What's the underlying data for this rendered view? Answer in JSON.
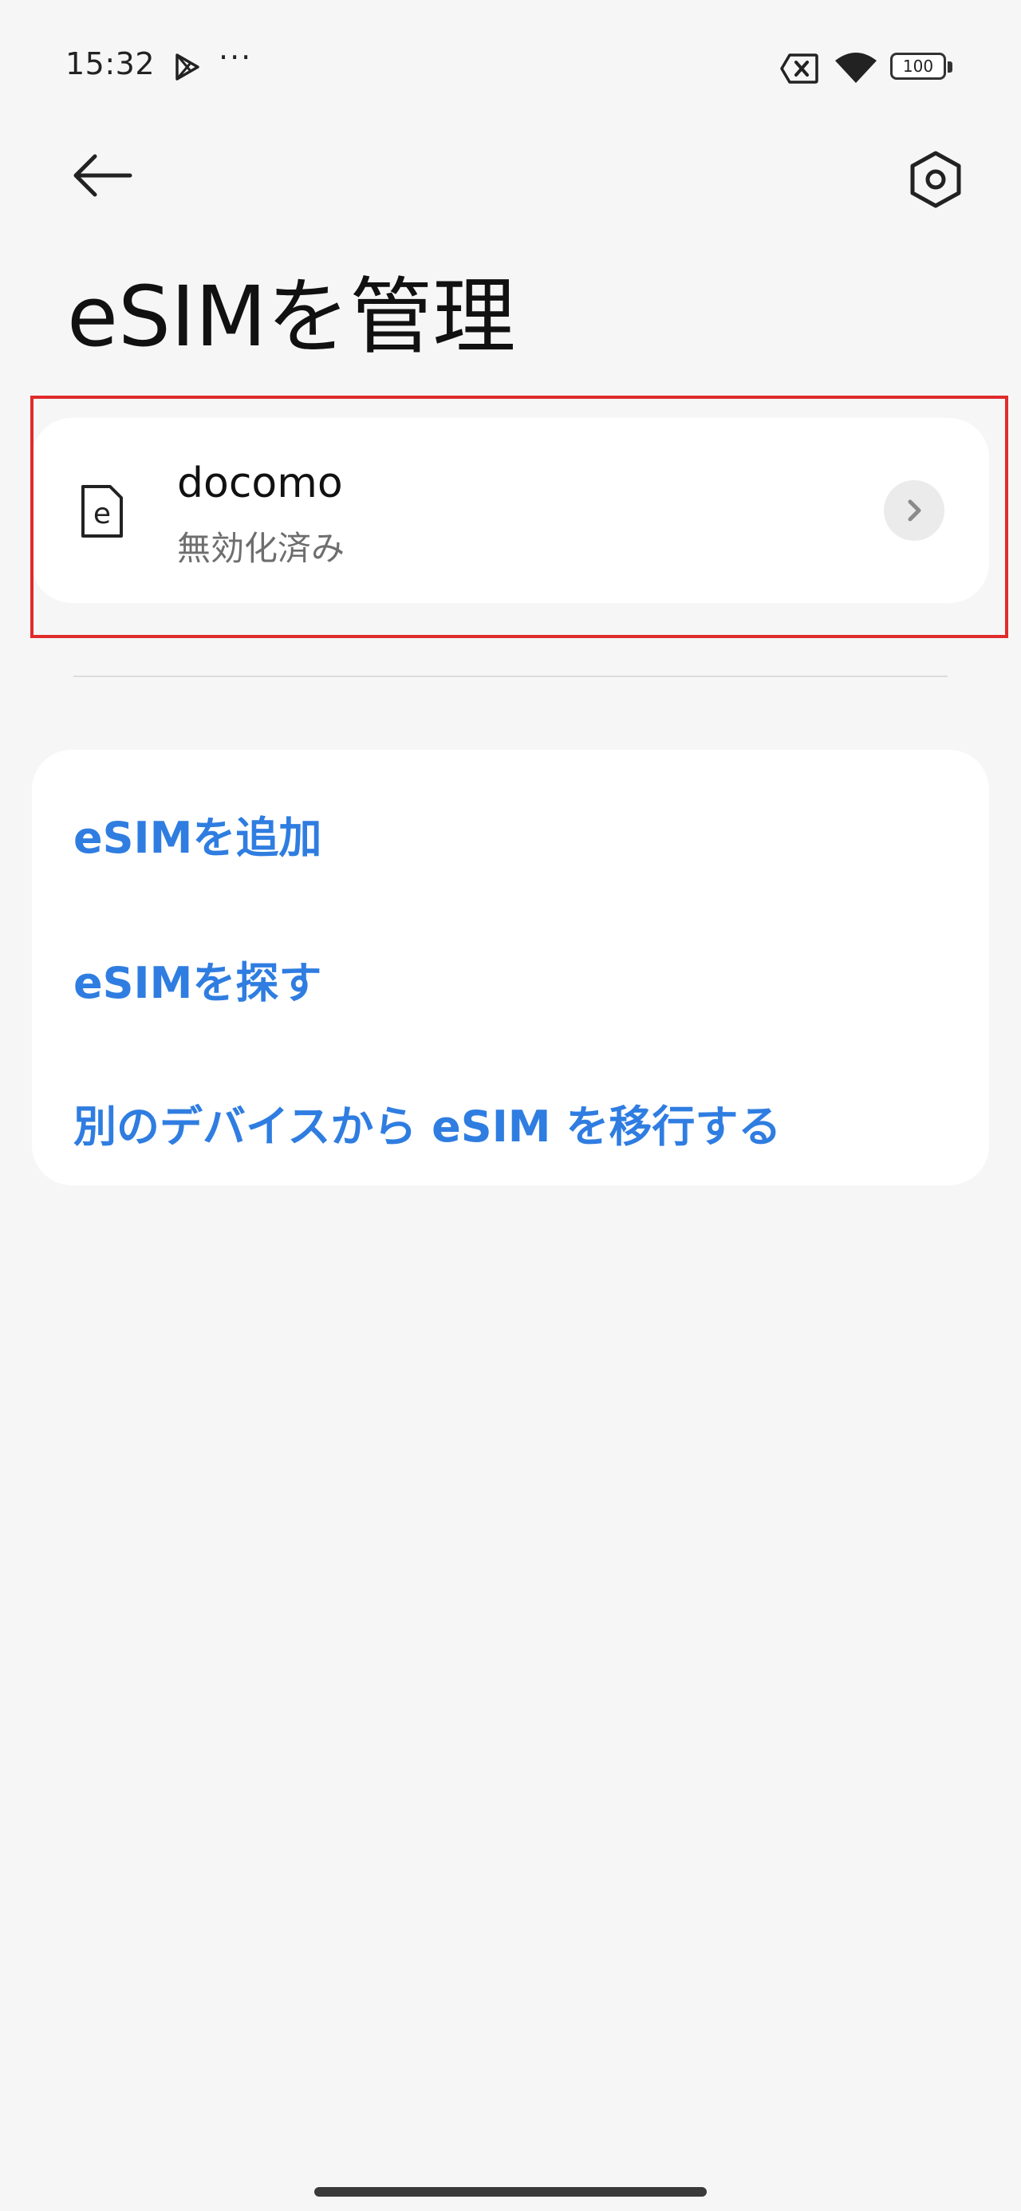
{
  "status_bar": {
    "time": "15:32",
    "more": "···",
    "battery_level": "100",
    "icons": [
      "play-store-icon",
      "sim-error-icon",
      "wifi-icon",
      "battery-icon"
    ]
  },
  "toolbar": {
    "back_icon": "arrow-left-icon",
    "settings_icon": "hexagon-settings-icon"
  },
  "page": {
    "title": "eSIMを管理"
  },
  "sim": {
    "name": "docomo",
    "status": "無効化済み",
    "icon": "esim-icon",
    "chevron_icon": "chevron-right-icon"
  },
  "actions": {
    "add_esim": "eSIMを追加",
    "find_esim": "eSIMを探す",
    "transfer_esim": "別のデバイスから eSIM を移行する"
  },
  "colors": {
    "background": "#f6f6f6",
    "card": "#ffffff",
    "accent": "#2f7de1",
    "highlight": "#e02b2b",
    "secondary_text": "#6e6e6e"
  }
}
